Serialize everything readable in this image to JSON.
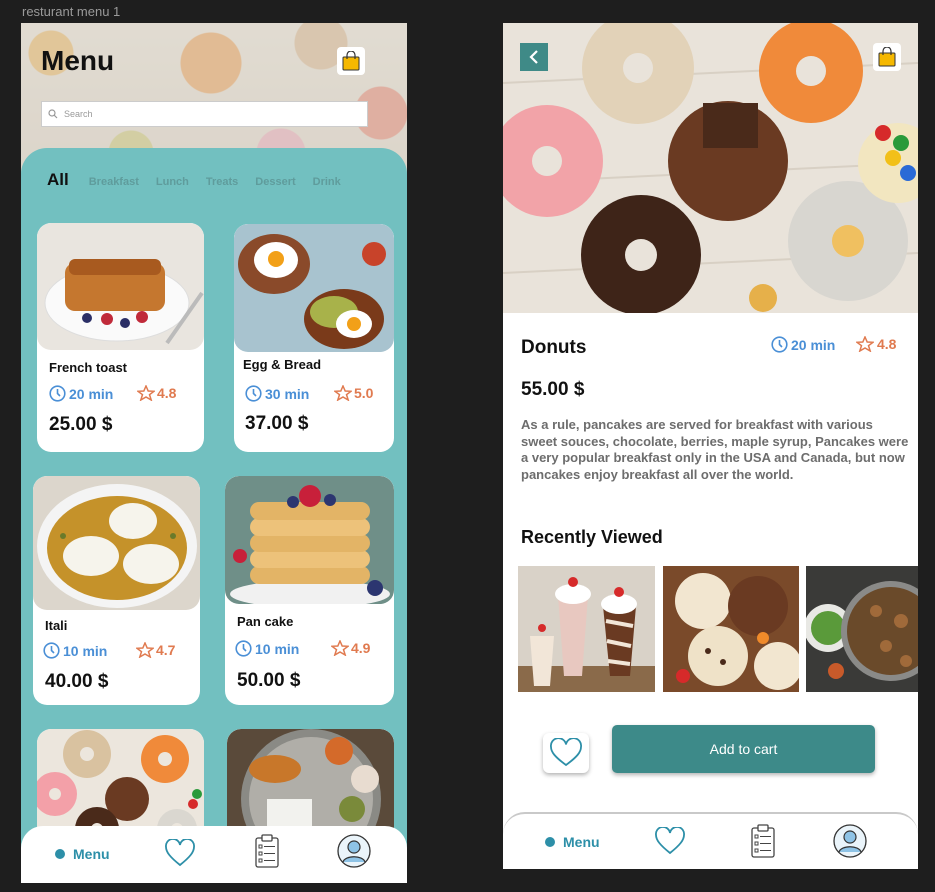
{
  "canvas_label": "resturant menu 1",
  "colors": {
    "teal": "#72c0c0",
    "accent": "#3d8a89",
    "blue": "#4a8fd6",
    "orange": "#e07a4f",
    "bag": "#f5b800"
  },
  "menu_screen": {
    "title": "Menu",
    "search_placeholder": "Search",
    "tabs": [
      "All",
      "Breakfast",
      "Lunch",
      "Treats",
      "Dessert",
      "Drink"
    ],
    "active_tab": "All",
    "items": [
      {
        "name": "French toast",
        "time": "20 min",
        "rating": "4.8",
        "price": "25.00 $"
      },
      {
        "name": "Egg & Bread",
        "time": "30 min",
        "rating": "5.0",
        "price": "37.00 $"
      },
      {
        "name": "Itali",
        "time": "10 min",
        "rating": "4.7",
        "price": "40.00 $"
      },
      {
        "name": "Pan cake",
        "time": "10 min",
        "rating": "4.9",
        "price": "50.00 $"
      }
    ],
    "nav": {
      "menu_label": "Menu",
      "icons": [
        "heart-icon",
        "clipboard-icon",
        "profile-icon"
      ]
    }
  },
  "detail_screen": {
    "title": "Donuts",
    "time": "20 min",
    "rating": "4.8",
    "price": "55.00 $",
    "description": "As a rule, pancakes are served for breakfast with various sweet souces, chocolate, berries, maple syrup, Pancakes were a very popular breakfast only in the USA and Canada, but now pancakes enjoy breakfast all over the world.",
    "recent_title": "Recently Viewed",
    "add_to_cart": "Add to cart",
    "nav": {
      "menu_label": "Menu"
    }
  }
}
